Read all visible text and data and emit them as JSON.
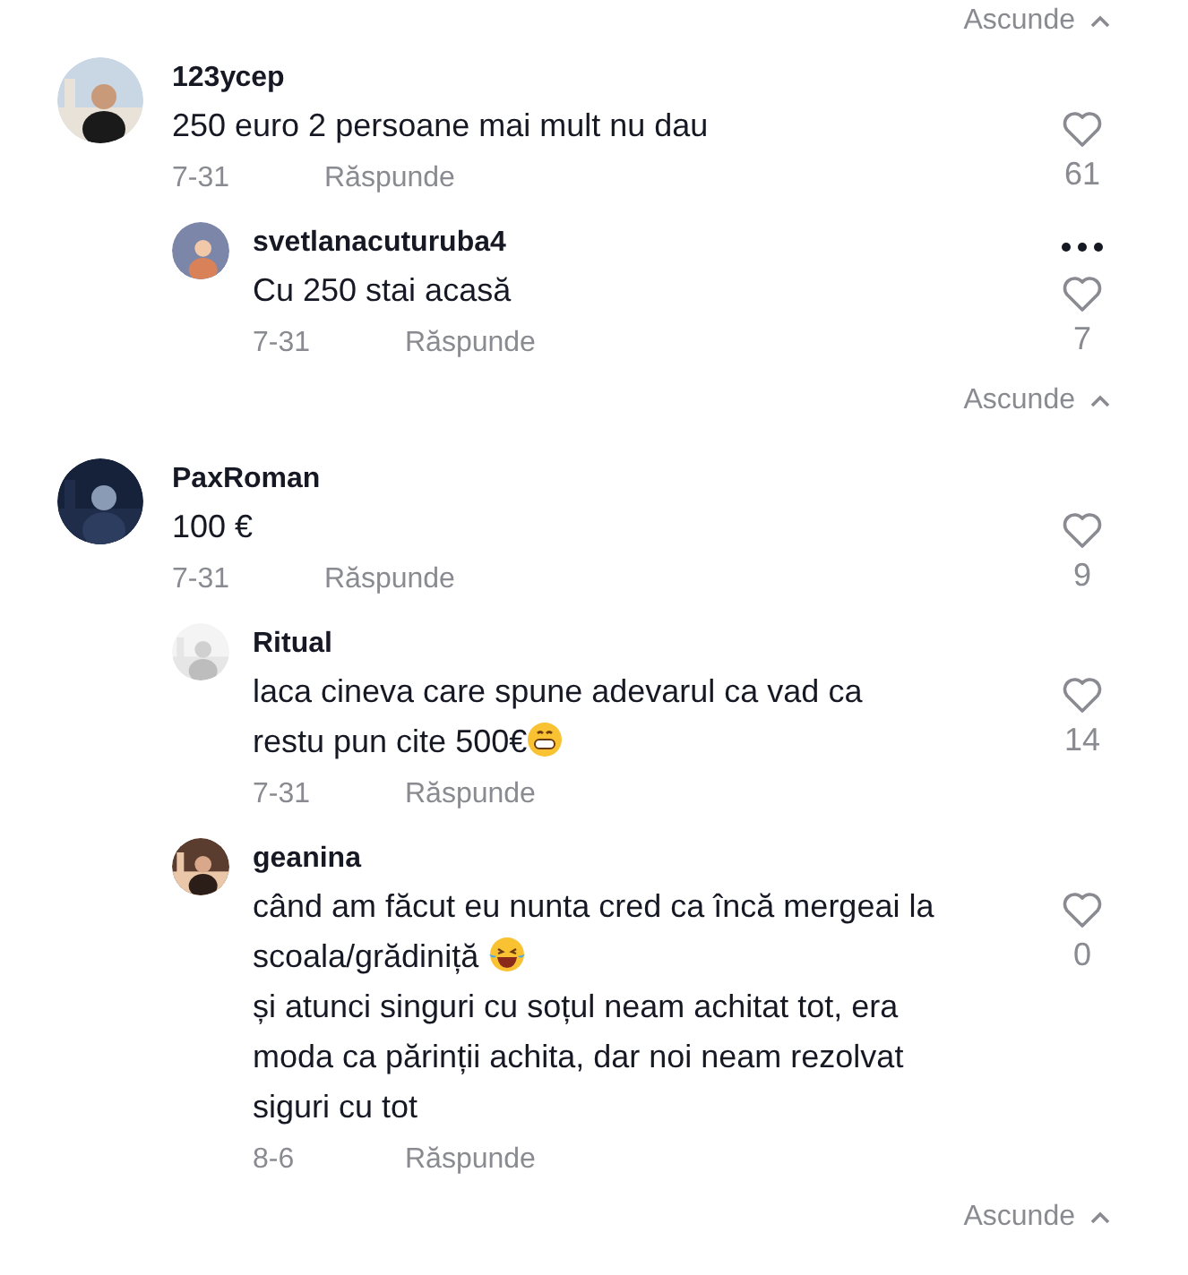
{
  "top_hide_link": {
    "label": "Ascunde"
  },
  "threads": [
    {
      "comment": {
        "user": "123усер",
        "avatar": {
          "kind": "picture"
        },
        "segments": [
          {
            "kind": "text",
            "text": "250 euro 2 persoane mai mult nu dau"
          }
        ],
        "date": "7-31",
        "reply_label": "Răspunde",
        "likes": "61",
        "menu_shown": false
      },
      "replies": [
        {
          "user": "svetlanacuturuba4",
          "avatar": {
            "kind": "picture"
          },
          "segments": [
            {
              "kind": "text",
              "text": "Cu 250 stai acasă"
            }
          ],
          "date": "7-31",
          "reply_label": "Răspunde",
          "likes": "7",
          "menu_shown": true
        }
      ],
      "hide_label": "Ascunde"
    },
    {
      "comment": {
        "user": "PaxRoman",
        "avatar": {
          "kind": "picture"
        },
        "segments": [
          {
            "kind": "text",
            "text": "100 €"
          }
        ],
        "date": "7-31",
        "reply_label": "Răspunde",
        "likes": "9",
        "menu_shown": false
      },
      "replies": [
        {
          "user": "Ritual",
          "avatar": {
            "kind": "picture"
          },
          "segments": [
            {
              "kind": "text",
              "text": "laca cineva care spune adevarul ca vad ca restu pun cite 500€"
            },
            {
              "kind": "grin"
            }
          ],
          "date": "7-31",
          "reply_label": "Răspunde",
          "likes": "14",
          "menu_shown": false
        },
        {
          "user": "geanina",
          "avatar": {
            "kind": "picture"
          },
          "segments": [
            {
              "kind": "text",
              "text": "când am făcut eu nunta cred ca încă mergeai la scoala/grădiniță "
            },
            {
              "kind": "tears-of-joy"
            },
            {
              "kind": "break"
            },
            {
              "kind": "text",
              "text": "și atunci singuri cu soțul neam achitat tot, era moda ca părinții achita, dar noi neam rezolvat siguri cu tot"
            }
          ],
          "date": "8-6",
          "reply_label": "Răspunde",
          "likes": "0",
          "menu_shown": false
        }
      ],
      "hide_label": "Ascunde"
    }
  ]
}
